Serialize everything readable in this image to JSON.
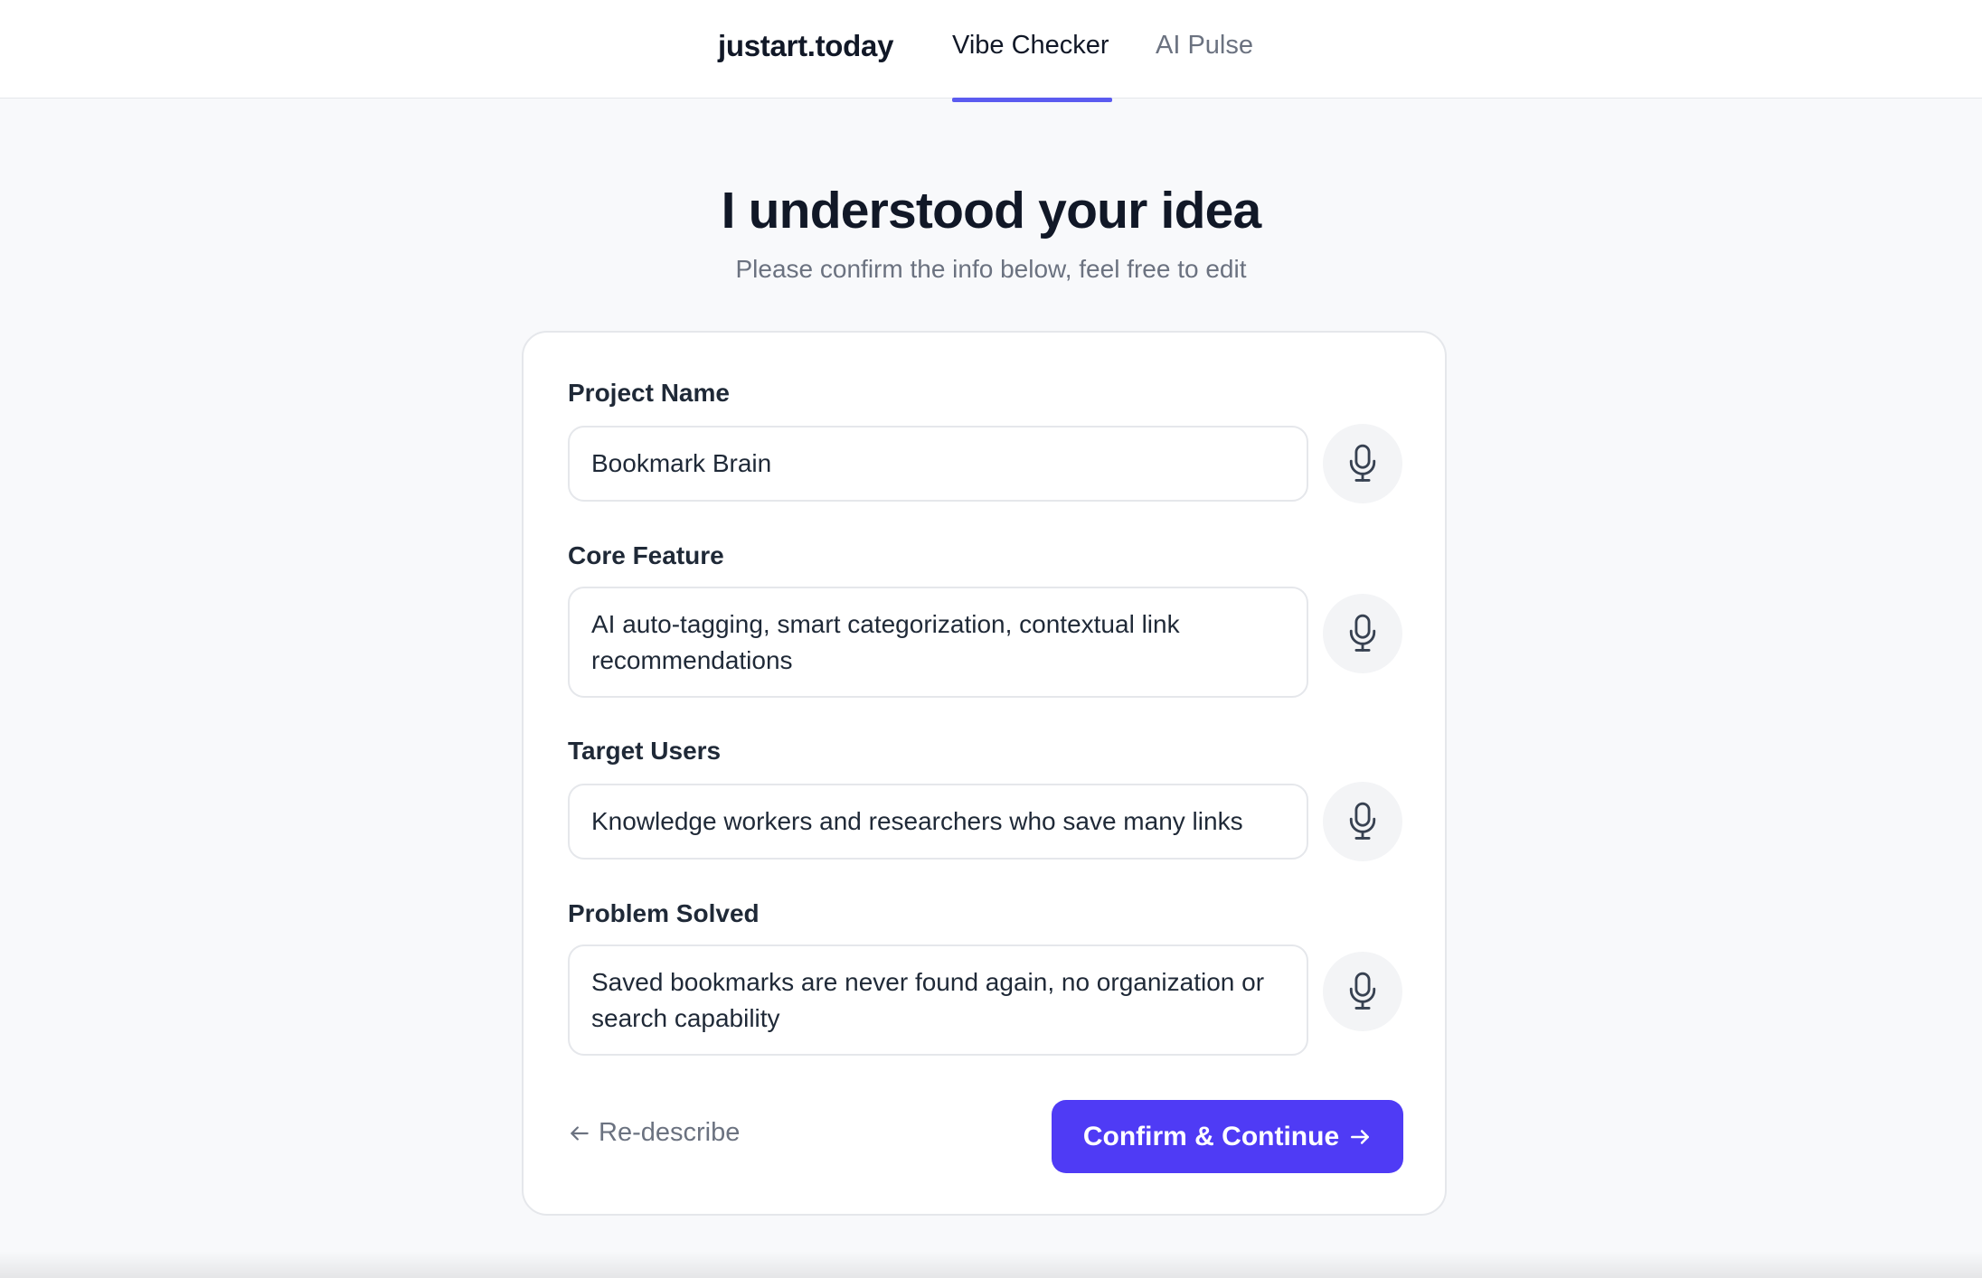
{
  "header": {
    "brand": "justart.today",
    "tabs": [
      {
        "label": "Vibe Checker",
        "active": true
      },
      {
        "label": "AI Pulse",
        "active": false
      }
    ],
    "accent_color": "#5b5bf0"
  },
  "main": {
    "title": "I understood your idea",
    "subtitle": "Please confirm the info below, feel free to edit"
  },
  "form": {
    "fields": [
      {
        "label": "Project Name",
        "value": "Bookmark Brain",
        "icon": "microphone-icon"
      },
      {
        "label": "Core Feature",
        "value": "AI auto-tagging, smart categorization, contextual link recommendations",
        "icon": "microphone-icon"
      },
      {
        "label": "Target Users",
        "value": "Knowledge workers and researchers who save many links",
        "icon": "microphone-icon"
      },
      {
        "label": "Problem Solved",
        "value": "Saved bookmarks are never found again, no organization or search capability",
        "icon": "microphone-icon"
      }
    ],
    "back_label": "Re-describe",
    "confirm_label": "Confirm & Continue",
    "button_color": "#4f3bf5"
  }
}
